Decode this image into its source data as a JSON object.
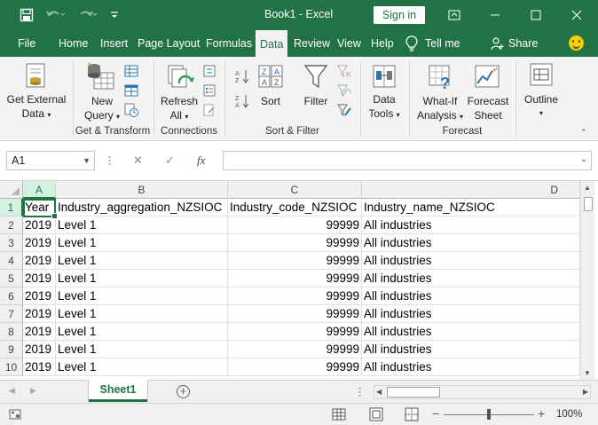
{
  "window": {
    "title": "Book1  -  Excel",
    "signin_label": "Sign in"
  },
  "tabs": [
    "File",
    "Home",
    "Insert",
    "Page Layout",
    "Formulas",
    "Data",
    "Review",
    "View",
    "Help"
  ],
  "active_tab": "Data",
  "tell_me": "Tell me",
  "share": "Share",
  "ribbon": {
    "get_external": [
      "Get External",
      "Data"
    ],
    "new_query": [
      "New",
      "Query"
    ],
    "refresh_all": [
      "Refresh",
      "All"
    ],
    "sort": "Sort",
    "filter": "Filter",
    "data_tools": [
      "Data",
      "Tools"
    ],
    "what_if": [
      "What-If",
      "Analysis"
    ],
    "forecast_sheet": [
      "Forecast",
      "Sheet"
    ],
    "outline": "Outline",
    "groups": {
      "get_transform": "Get & Transform",
      "connections": "Connections",
      "sort_filter": "Sort & Filter",
      "forecast": "Forecast"
    }
  },
  "formula_bar": {
    "name_box": "A1",
    "fx": "fx",
    "cancel": "✕",
    "enter": "✓",
    "content": ""
  },
  "columns": [
    "A",
    "B",
    "C",
    "D"
  ],
  "rows": [
    [
      "Year",
      "Industry_aggregation_NZSIOC",
      "Industry_code_NZSIOC",
      "Industry_name_NZSIOC"
    ],
    [
      "2019",
      "Level 1",
      "99999",
      "All industries"
    ],
    [
      "2019",
      "Level 1",
      "99999",
      "All industries"
    ],
    [
      "2019",
      "Level 1",
      "99999",
      "All industries"
    ],
    [
      "2019",
      "Level 1",
      "99999",
      "All industries"
    ],
    [
      "2019",
      "Level 1",
      "99999",
      "All industries"
    ],
    [
      "2019",
      "Level 1",
      "99999",
      "All industries"
    ],
    [
      "2019",
      "Level 1",
      "99999",
      "All industries"
    ],
    [
      "2019",
      "Level 1",
      "99999",
      "All industries"
    ],
    [
      "2019",
      "Level 1",
      "99999",
      "All industries"
    ]
  ],
  "row_numbers": [
    "1",
    "2",
    "3",
    "4",
    "5",
    "6",
    "7",
    "8",
    "9",
    "10"
  ],
  "sheet_tab": "Sheet1",
  "status": {
    "zoom": "100%",
    "zoom_minus": "−",
    "zoom_plus": "+"
  },
  "colors": {
    "accent": "#217346"
  }
}
